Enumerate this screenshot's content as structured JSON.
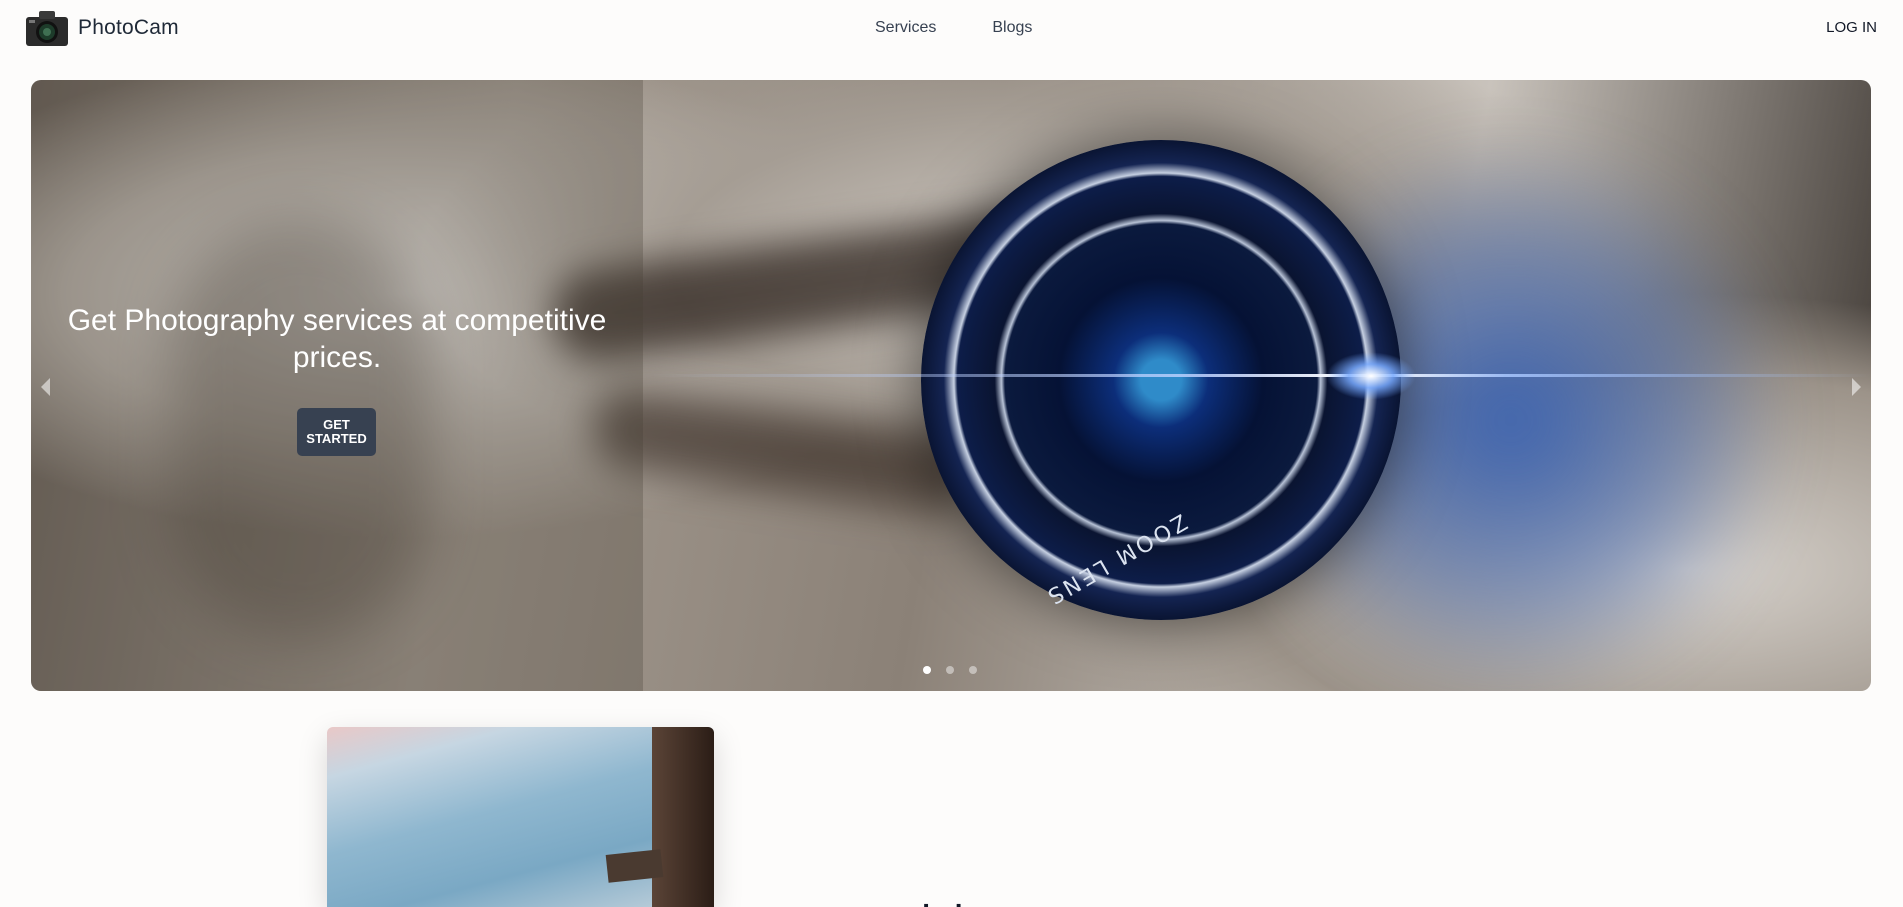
{
  "nav": {
    "brand": "PhotoCam",
    "links": [
      "Services",
      "Blogs"
    ],
    "login": "LOG IN"
  },
  "hero": {
    "tagline": "Get Photography services at competitive prices.",
    "cta_line1": "GET",
    "cta_line2": "STARTED",
    "lens_text": "ZOOM LENS",
    "slide_count": 3,
    "active_slide": 1
  },
  "section": {
    "heading_partial": "ı ı"
  },
  "icons": {
    "logo": "camera-icon",
    "prev": "chevron-left-icon",
    "next": "chevron-right-icon"
  }
}
